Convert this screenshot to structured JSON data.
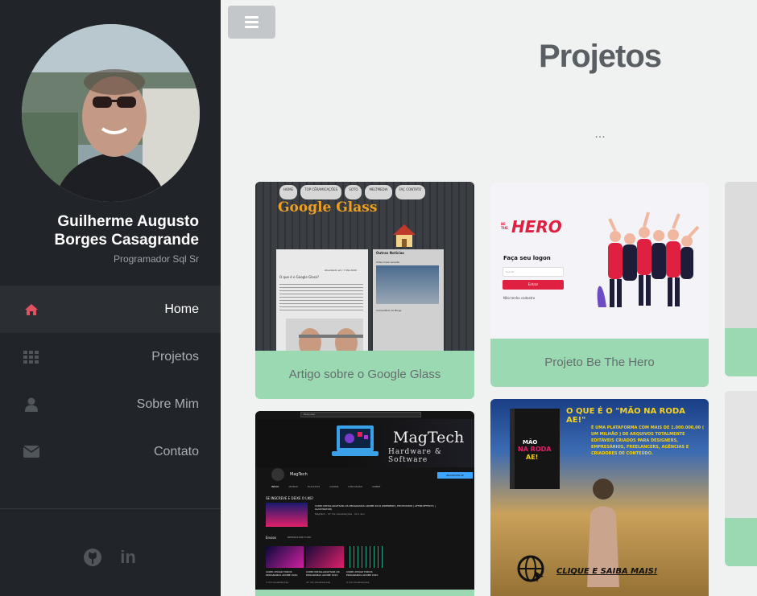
{
  "sidebar": {
    "name": "Guilherme Augusto Borges Casagrande",
    "role": "Programador Sql Sr",
    "nav": [
      {
        "label": "Home",
        "icon": "home-icon",
        "active": true
      },
      {
        "label": "Projetos",
        "icon": "grid-icon",
        "active": false
      },
      {
        "label": "Sobre Mim",
        "icon": "user-icon",
        "active": false
      },
      {
        "label": "Contato",
        "icon": "envelope-icon",
        "active": false
      }
    ],
    "socials": [
      {
        "icon": "github-icon"
      },
      {
        "icon": "linkedin-icon",
        "text": "in"
      }
    ]
  },
  "main": {
    "title": "Projetos",
    "subtitle": "...",
    "projects": [
      {
        "label": "Artigo sobre o Google Glass",
        "thumb": {
          "heading": "Google Glass",
          "nav": [
            "HOME",
            "TOP CÊRAMICAÇÕES",
            "SOTO",
            "MELTMEDIA",
            "FAÇ CONTATO"
          ],
          "sidebar_title": "Outras Noticias",
          "sidebar_sub": "Vídeo mais recente",
          "sidebar_sub2": "Comentário do Blogs",
          "date": "Atualizado em: Y Mai 2020",
          "question": "O que é o Google Glass?"
        }
      },
      {
        "label": "Projeto Be The Hero",
        "thumb": {
          "logo_small": "BE THE",
          "logo": "HERO",
          "form_title": "Faça seu logon",
          "input_placeholder": "Sua ID",
          "button": "Entrar",
          "link": "Não tenho cadastro"
        }
      },
      {
        "label": "",
        "thumb": {
          "search": "Pesquisar",
          "brand": "MagTech",
          "brand_sub": "Hardware & Software",
          "channel": "MagTech",
          "subscribe": "INSCREVER-SE",
          "tabs": [
            "INÍCIO",
            "VÍDEOS",
            "PLAYLISTS",
            "CANAIS",
            "DISCUSSÃO",
            "SOBRE"
          ],
          "section": "SE INSCREVE E DEIXE O LIKE!",
          "video_title": "COMO INSTALAR/ATIVAR OS PROGRAMAS ADOBE 2019 (PREMIERE | PHOTOSHOP | AFTER EFFECTS | ILLUSTRATOR)",
          "video_meta": "MagTech · 47 mil visualizações · há 1 ano",
          "section2": "Envios",
          "section2_action": "REPRODUZIR TUDO",
          "thumbs": [
            {
              "title": "COMO ATIVAR TODOS PROGRAMAS ADOBE 2020",
              "meta": "3 mil visualizações"
            },
            {
              "title": "COMO INSTALAR/ATIVAR OS PROGRAMAS ADOBE 2019",
              "meta": "47 mil visualizações"
            },
            {
              "title": "COMO ATIVAR TODOS PROGRAMAS ADOBE 2020",
              "meta": "2 mil visualizações"
            }
          ]
        }
      },
      {
        "label": "",
        "thumb": {
          "heading": "O QUE É O \"MÃO NA RODA AE!\"",
          "text": "É UMA PLATAFORMA COM MAIS DE 1.000.000,00 ( UM MILHÃO ) DE ARQUIVOS TOTALMENTE EDITÁVEIS CRIADOS PARA DESIGNERS, EMPRESÁRIOS, FREELANCERS, AGÊNCIAS E CRIADORES DE CONTEÚDO.",
          "box_line1": "MÃO",
          "box_line2": "NA RODA",
          "box_line3": "AE!",
          "cta": "CLIQUE E SAIBA MAIS!"
        }
      },
      {
        "label": ""
      },
      {
        "label": ""
      }
    ]
  },
  "colors": {
    "sidebar_bg": "#212529",
    "active_item_bg": "#2b2f33",
    "accent_red": "#e05260",
    "card_green": "#9ad9b1",
    "page_bg": "#f0f2f1",
    "hero_red": "#e02041"
  }
}
